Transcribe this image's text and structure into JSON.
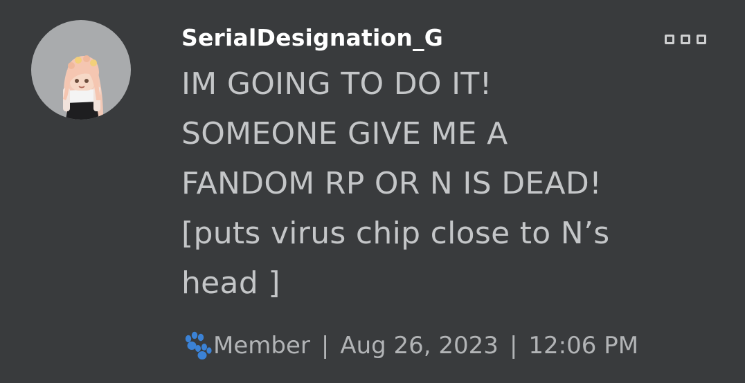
{
  "post": {
    "username": "SerialDesignation_G",
    "message": "IM GOING TO DO IT!\nSOMEONE GIVE ME A\nFANDOM RP OR N IS DEAD!\n[puts virus chip close to N’s\nhead ]",
    "role": "Member",
    "separator": "|",
    "date": "Aug 26, 2023",
    "time": "12:06 PM"
  },
  "icons": {
    "role_icon": "paw-icon",
    "menu_icon": "more-options-icon"
  },
  "colors": {
    "background": "#393b3d",
    "username": "#ffffff",
    "message": "#c4c6c8",
    "meta": "#b2b4b6",
    "paw": "#3b82d6"
  }
}
